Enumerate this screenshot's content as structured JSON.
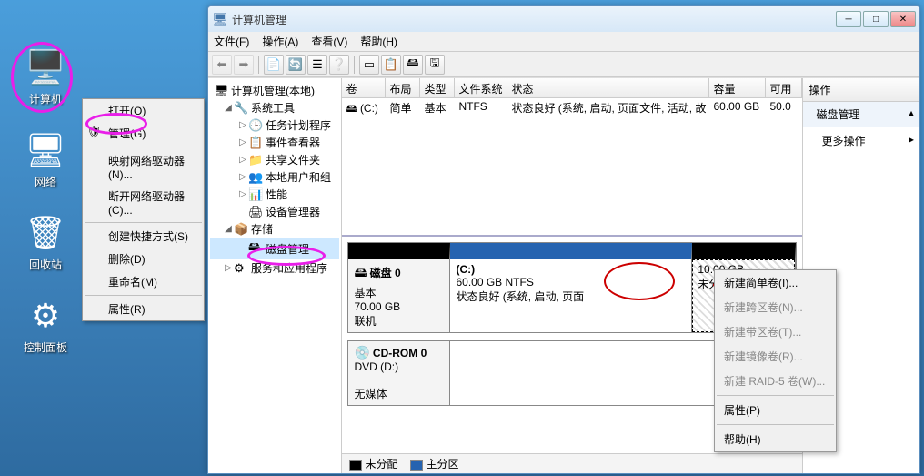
{
  "desktop": {
    "icons": [
      {
        "label": "计算机",
        "glyph": "🖥️"
      },
      {
        "label": "网络",
        "glyph": "🖥"
      },
      {
        "label": "回收站",
        "glyph": "🗑"
      },
      {
        "label": "控制面板",
        "glyph": "⚙"
      }
    ]
  },
  "desk_menu": {
    "items": [
      {
        "label": "打开(O)"
      },
      {
        "label": "管理(G)"
      },
      {
        "sep": true
      },
      {
        "label": "映射网络驱动器(N)..."
      },
      {
        "label": "断开网络驱动器(C)..."
      },
      {
        "sep": true
      },
      {
        "label": "创建快捷方式(S)"
      },
      {
        "label": "删除(D)"
      },
      {
        "label": "重命名(M)"
      },
      {
        "sep": true
      },
      {
        "label": "属性(R)"
      }
    ]
  },
  "window": {
    "title": "计算机管理",
    "menu": [
      "文件(F)",
      "操作(A)",
      "查看(V)",
      "帮助(H)"
    ]
  },
  "tree": {
    "root": "计算机管理(本地)",
    "storage": "存储",
    "disk_mgmt": "磁盘管理",
    "sys_tools": "系统工具",
    "services": "服务和应用程序",
    "nodes": [
      "任务计划程序",
      "事件查看器",
      "共享文件夹",
      "本地用户和组",
      "性能",
      "设备管理器"
    ]
  },
  "vol_headers": [
    "卷",
    "布局",
    "类型",
    "文件系统",
    "状态",
    "容量",
    "可用"
  ],
  "vol_row": {
    "vol": "(C:)",
    "layout": "简单",
    "type": "基本",
    "fs": "NTFS",
    "status": "状态良好 (系统, 启动, 页面文件, 活动, 故",
    "cap": "60.00 GB",
    "free": "50.0"
  },
  "disk0": {
    "title": "磁盘 0",
    "kind": "基本",
    "size": "70.00 GB",
    "state": "联机",
    "part_c": {
      "label": "(C:)",
      "size": "60.00 GB NTFS",
      "status": "状态良好 (系统, 启动, 页面"
    },
    "part_u": {
      "size": "10.00 GB",
      "status": "未分配"
    }
  },
  "cdrom": {
    "title": "CD-ROM 0",
    "drive": "DVD (D:)",
    "status": "无媒体"
  },
  "legend": {
    "unalloc": "未分配",
    "primary": "主分区"
  },
  "actions": {
    "header": "操作",
    "section": "磁盘管理",
    "more": "更多操作"
  },
  "part_menu": {
    "items": [
      {
        "label": "新建简单卷(I)..."
      },
      {
        "label": "新建跨区卷(N)...",
        "dis": true
      },
      {
        "label": "新建带区卷(T)...",
        "dis": true
      },
      {
        "label": "新建镜像卷(R)...",
        "dis": true
      },
      {
        "label": "新建 RAID-5 卷(W)...",
        "dis": true
      },
      {
        "sep": true
      },
      {
        "label": "属性(P)"
      },
      {
        "sep": true
      },
      {
        "label": "帮助(H)"
      }
    ]
  }
}
